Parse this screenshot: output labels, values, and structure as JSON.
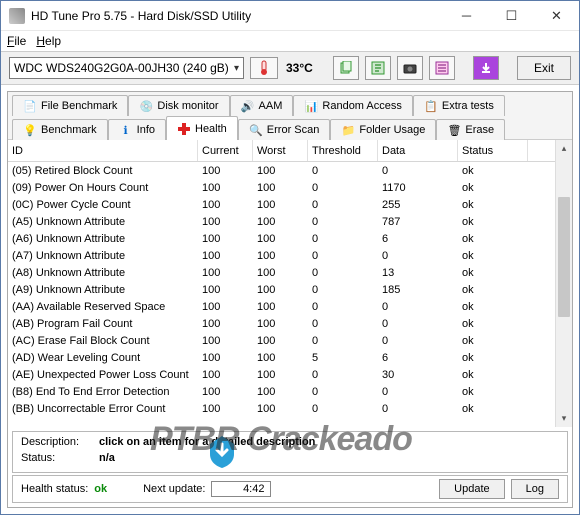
{
  "window": {
    "title": "HD Tune Pro 5.75 - Hard Disk/SSD Utility"
  },
  "menu": {
    "file": "File",
    "help": "Help"
  },
  "toolbar": {
    "drive": "WDC WDS240G2G0A-00JH30 (240 gB)",
    "temp": "33°C",
    "exit": "Exit"
  },
  "tabs_top": {
    "file_benchmark": "File Benchmark",
    "disk_monitor": "Disk monitor",
    "aam": "AAM",
    "random_access": "Random Access",
    "extra_tests": "Extra tests"
  },
  "tabs_bottom": {
    "benchmark": "Benchmark",
    "info": "Info",
    "health": "Health",
    "error_scan": "Error Scan",
    "folder_usage": "Folder Usage",
    "erase": "Erase"
  },
  "table": {
    "headers": {
      "id": "ID",
      "current": "Current",
      "worst": "Worst",
      "threshold": "Threshold",
      "data": "Data",
      "status": "Status"
    },
    "rows": [
      {
        "id": "(05) Retired Block Count",
        "current": "100",
        "worst": "100",
        "threshold": "0",
        "data": "0",
        "status": "ok"
      },
      {
        "id": "(09) Power On Hours Count",
        "current": "100",
        "worst": "100",
        "threshold": "0",
        "data": "1170",
        "status": "ok"
      },
      {
        "id": "(0C) Power Cycle Count",
        "current": "100",
        "worst": "100",
        "threshold": "0",
        "data": "255",
        "status": "ok"
      },
      {
        "id": "(A5) Unknown Attribute",
        "current": "100",
        "worst": "100",
        "threshold": "0",
        "data": "787",
        "status": "ok"
      },
      {
        "id": "(A6) Unknown Attribute",
        "current": "100",
        "worst": "100",
        "threshold": "0",
        "data": "6",
        "status": "ok"
      },
      {
        "id": "(A7) Unknown Attribute",
        "current": "100",
        "worst": "100",
        "threshold": "0",
        "data": "0",
        "status": "ok"
      },
      {
        "id": "(A8) Unknown Attribute",
        "current": "100",
        "worst": "100",
        "threshold": "0",
        "data": "13",
        "status": "ok"
      },
      {
        "id": "(A9) Unknown Attribute",
        "current": "100",
        "worst": "100",
        "threshold": "0",
        "data": "185",
        "status": "ok"
      },
      {
        "id": "(AA) Available Reserved Space",
        "current": "100",
        "worst": "100",
        "threshold": "0",
        "data": "0",
        "status": "ok"
      },
      {
        "id": "(AB) Program Fail Count",
        "current": "100",
        "worst": "100",
        "threshold": "0",
        "data": "0",
        "status": "ok"
      },
      {
        "id": "(AC) Erase Fail Block Count",
        "current": "100",
        "worst": "100",
        "threshold": "0",
        "data": "0",
        "status": "ok"
      },
      {
        "id": "(AD) Wear Leveling Count",
        "current": "100",
        "worst": "100",
        "threshold": "5",
        "data": "6",
        "status": "ok"
      },
      {
        "id": "(AE) Unexpected Power Loss Count",
        "current": "100",
        "worst": "100",
        "threshold": "0",
        "data": "30",
        "status": "ok"
      },
      {
        "id": "(B8) End To End Error Detection",
        "current": "100",
        "worst": "100",
        "threshold": "0",
        "data": "0",
        "status": "ok"
      },
      {
        "id": "(BB) Uncorrectable Error Count",
        "current": "100",
        "worst": "100",
        "threshold": "0",
        "data": "0",
        "status": "ok"
      }
    ]
  },
  "desc": {
    "description_label": "Description:",
    "description_value": "click on an item for a detailed description",
    "status_label": "Status:",
    "status_value": "n/a"
  },
  "footer": {
    "health_label": "Health status:",
    "health_value": "ok",
    "next_update_label": "Next update:",
    "next_update_value": "4:42",
    "update_btn": "Update",
    "log_btn": "Log"
  },
  "watermark": "PTBR Crackeado"
}
